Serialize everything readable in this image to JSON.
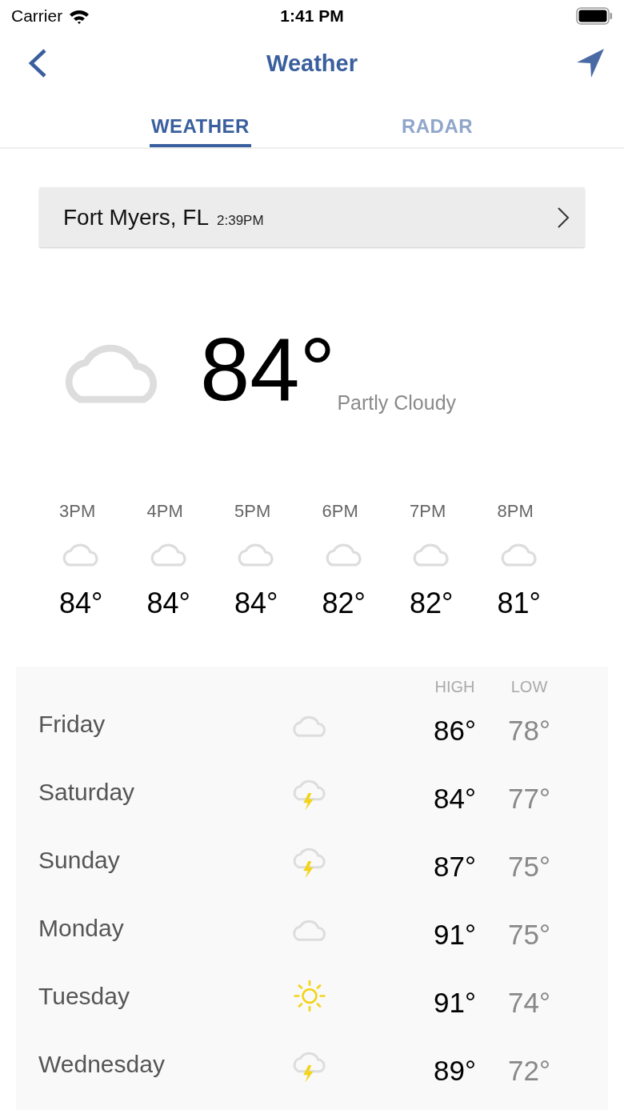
{
  "status_bar": {
    "carrier": "Carrier",
    "time": "1:41 PM"
  },
  "nav": {
    "title": "Weather"
  },
  "tabs": [
    {
      "label": "WEATHER",
      "selected": true
    },
    {
      "label": "RADAR",
      "selected": false
    }
  ],
  "location": {
    "name": "Fort Myers, FL",
    "time": "2:39PM"
  },
  "current": {
    "temperature": "84°",
    "condition": "Partly Cloudy",
    "kind": "cloud"
  },
  "hourly": [
    {
      "time": "3PM",
      "kind": "cloud",
      "temperature": "84°"
    },
    {
      "time": "4PM",
      "kind": "cloud",
      "temperature": "84°"
    },
    {
      "time": "5PM",
      "kind": "cloud",
      "temperature": "84°"
    },
    {
      "time": "6PM",
      "kind": "cloud",
      "temperature": "82°"
    },
    {
      "time": "7PM",
      "kind": "cloud",
      "temperature": "82°"
    },
    {
      "time": "8PM",
      "kind": "cloud",
      "temperature": "81°"
    }
  ],
  "forecast": {
    "columns": [
      "HIGH",
      "LOW"
    ],
    "days": [
      {
        "day": "Friday",
        "kind": "cloud",
        "high": "86°",
        "low": "78°"
      },
      {
        "day": "Saturday",
        "kind": "storm",
        "high": "84°",
        "low": "77°"
      },
      {
        "day": "Sunday",
        "kind": "storm",
        "high": "87°",
        "low": "75°"
      },
      {
        "day": "Monday",
        "kind": "cloud",
        "high": "91°",
        "low": "75°"
      },
      {
        "day": "Tuesday",
        "kind": "sun",
        "high": "91°",
        "low": "74°"
      },
      {
        "day": "Wednesday",
        "kind": "storm",
        "high": "89°",
        "low": "72°"
      }
    ]
  }
}
